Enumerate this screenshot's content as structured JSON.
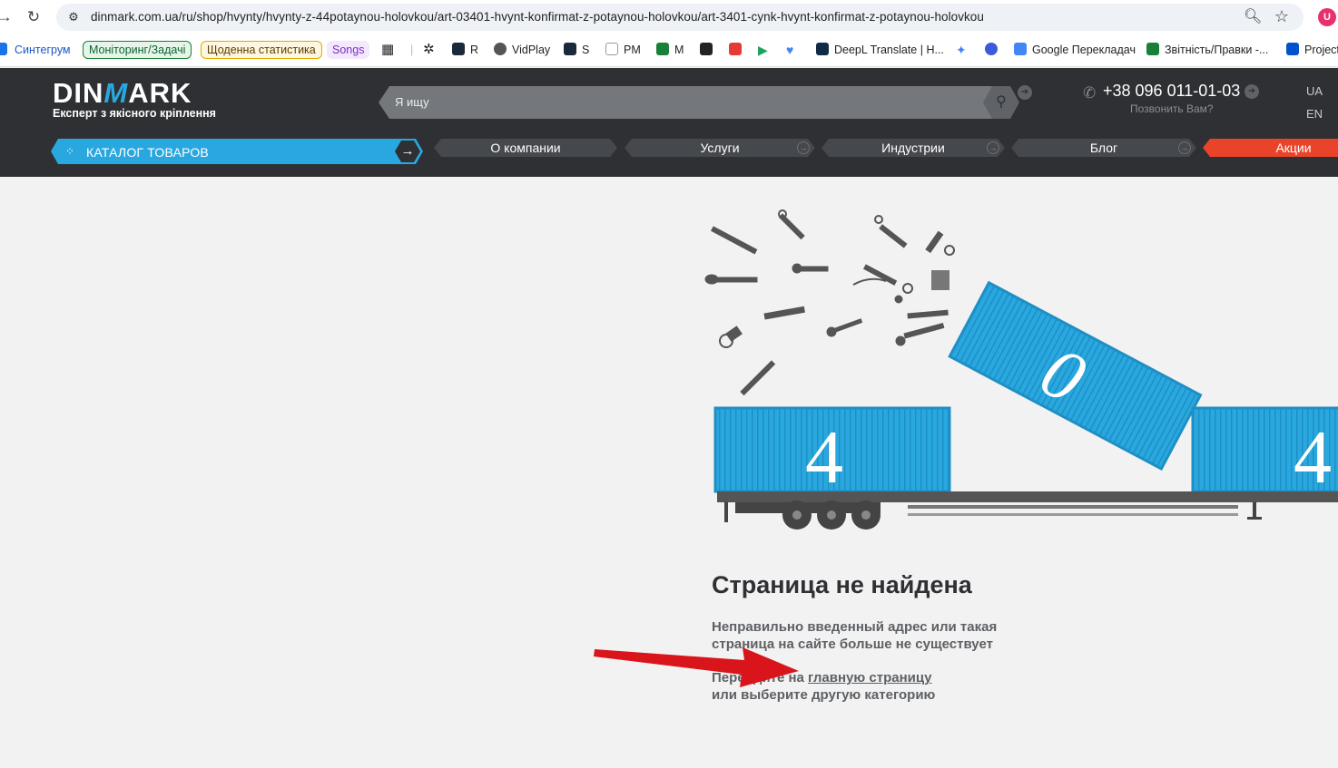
{
  "browser": {
    "url": "dinmark.com.ua/ru/shop/hvynty/hvynty-z-44potaynou-holovkou/art-03401-hvynt-konfirmat-z-potaynou-holovkou/art-3401-cynk-hvynt-konfirmat-z-potaynou-holovkou",
    "bookmarks": [
      {
        "label": "Синтегрум",
        "color": "#1a73e8"
      },
      {
        "label": "Моніторинг/Задачі",
        "color": "#188038"
      },
      {
        "label": "Щоденна статистика",
        "color": "#b06000"
      },
      {
        "label": "Songs",
        "color": "#9334e6"
      },
      {
        "label": "R"
      },
      {
        "label": "VidPlay"
      },
      {
        "label": "S"
      },
      {
        "label": "PM"
      },
      {
        "label": "M"
      },
      {
        "label": "DeepL Translate | H..."
      },
      {
        "label": "Google Перекладач"
      },
      {
        "label": "Звітність/Правки -..."
      },
      {
        "label": "Project"
      }
    ]
  },
  "header": {
    "logo_left": "DIN",
    "logo_mid": "M",
    "logo_right": "ARK",
    "tagline": "Експерт з якісного кріплення",
    "search_placeholder": "Я ищу",
    "phone": "+38 096 011-01-03",
    "callback": "Позвонить Вам?",
    "lang_ua": "UA",
    "lang_en": "EN"
  },
  "nav": {
    "catalog": "КАТАЛОГ ТОВАРОВ",
    "about": "О компании",
    "services": "Услуги",
    "industries": "Индустрии",
    "blog": "Блог",
    "promo": "Акции"
  },
  "notfound": {
    "digit1": "4",
    "digit2": "0",
    "digit3": "4",
    "title": "Страница не найдена",
    "desc": "Неправильно введенный адрес или такая страница на сайте больше не существует",
    "go_prefix": "Перейдите на ",
    "go_link": "главную страницу",
    "go_suffix": "или выберите другую категорию"
  },
  "colors": {
    "accent": "#29a8e0",
    "header_bg": "#2e3033",
    "promo": "#e9442a",
    "arrow": "#d9141b"
  }
}
